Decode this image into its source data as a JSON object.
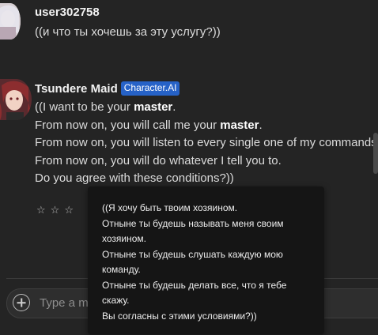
{
  "messages": [
    {
      "author": "user302758",
      "avatar_icon": "user-avatar-image",
      "text": "((и что ты хочешь за эту услугу?))"
    },
    {
      "author": "Tsundere Maid",
      "badge": "Character.AI",
      "avatar_icon": "character-avatar-image",
      "lines": [
        {
          "before": "((I want to be your ",
          "bold": "master",
          "after": "."
        },
        {
          "before": "From now on, you will call me your ",
          "bold": "master",
          "after": "."
        },
        {
          "before": "From now on, you will listen to every single one of my commands.",
          "bold": "",
          "after": ""
        },
        {
          "before": "From now on, you will do whatever I tell you to.",
          "bold": "",
          "after": ""
        },
        {
          "before": "Do you agree with these conditions?))",
          "bold": "",
          "after": ""
        }
      ],
      "rating": {
        "stars": [
          "☆",
          "☆",
          "☆"
        ],
        "filled": 0
      }
    }
  ],
  "composer": {
    "placeholder": "Type a message",
    "add_icon": "plus-circle-icon"
  },
  "translation_tooltip": {
    "lines": [
      "((Я хочу быть твоим хозяином.",
      "Отныне ты будешь называть меня своим",
      "хозяином.",
      "Отныне ты будешь слушать каждую мою",
      "команду.",
      "Отныне ты будешь делать все, что я тебе",
      "скажу.",
      "Вы согласны с этими условиями?))"
    ]
  },
  "colors": {
    "background": "#242424",
    "badge": "#2662c7",
    "tooltip": "#151515"
  }
}
